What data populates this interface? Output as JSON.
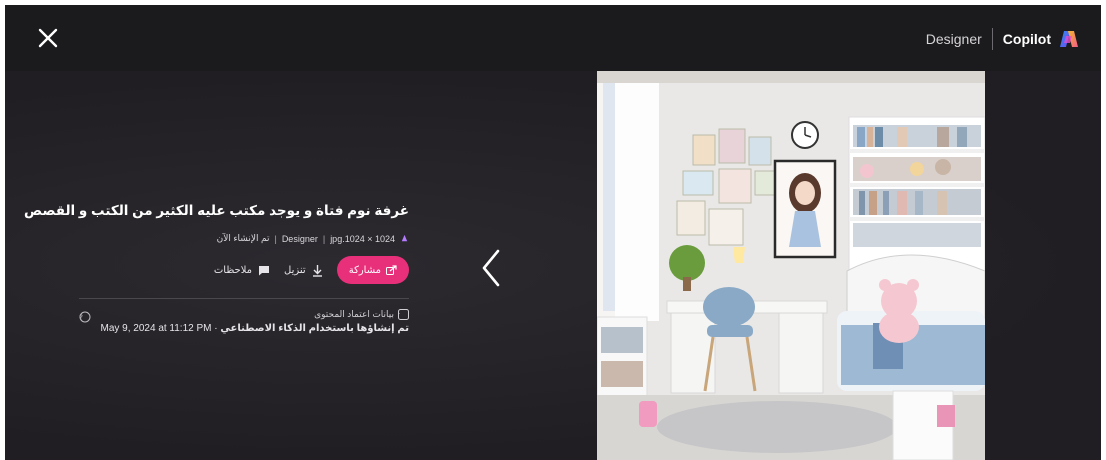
{
  "header": {
    "close_label": "",
    "designer_link": "Designer",
    "brand_name": "Copilot"
  },
  "info": {
    "title": "غرفة نوم فتاة و يوجد مكتب عليه الكثير من الكتب و القصص",
    "meta_created": "تم الإنشاء الآن",
    "meta_sep1": "|",
    "meta_source": "Designer",
    "meta_sep2": "|",
    "meta_file": "jpg.1024 × 1024"
  },
  "actions": {
    "share_label": "مشاركة",
    "download_label": "تنزيل",
    "feedback_label": "ملاحظات"
  },
  "credentials": {
    "heading": "بيانات اعتماد المحتوى",
    "ai_text": "تم إنشاؤها باستخدام الذكاء الاصطناعي",
    "separator": " · ",
    "date": "May 9, 2024 at 11:12 PM"
  },
  "colors": {
    "accent": "#e8307a",
    "background": "#1e1c1f",
    "topbar": "#1b1a1c"
  },
  "icons": {
    "close": "close-icon",
    "previous": "chevron-left-icon",
    "share": "share-icon",
    "download": "download-icon",
    "feedback": "feedback-icon",
    "credentials": "content-credentials-icon",
    "help": "help-circle-icon",
    "copilot": "copilot-logo"
  },
  "image": {
    "alt": "غرفة نوم فتاة و يوجد مكتب عليه الكثير من الكتب و القصص"
  }
}
